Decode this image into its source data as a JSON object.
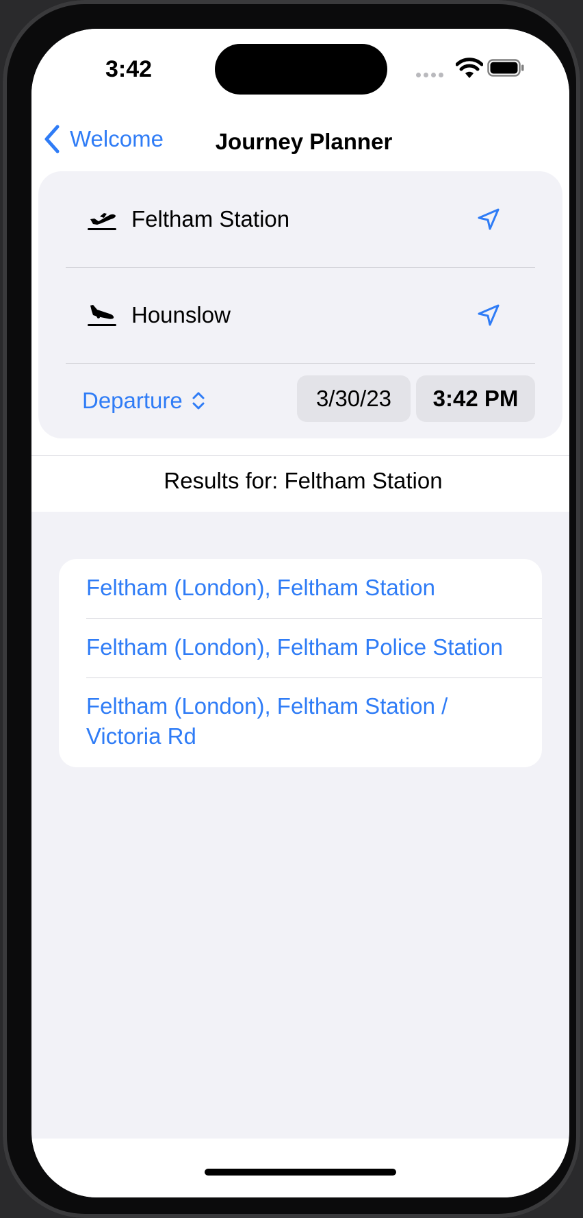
{
  "status_bar": {
    "time": "3:42"
  },
  "nav": {
    "back_label": "Welcome",
    "title": "Journey Planner"
  },
  "form": {
    "from": "Feltham Station",
    "to": "Hounslow",
    "mode": "Departure",
    "date": "3/30/23",
    "time": "3:42 PM"
  },
  "results": {
    "header": "Results for: Feltham Station",
    "items": [
      {
        "label": "Feltham (London), Feltham Station"
      },
      {
        "label": "Feltham (London), Feltham Police Station"
      },
      {
        "label": "Feltham (London), Feltham Station / Victoria Rd"
      }
    ]
  },
  "colors": {
    "accent": "#2f7cf6",
    "background": "#f2f2f7",
    "card": "#ffffff"
  },
  "icons": [
    "chevron-left-icon",
    "airplane-departure-icon",
    "airplane-arrival-icon",
    "location-arrow-icon",
    "chevron-up-down-icon",
    "wifi-icon",
    "battery-icon"
  ]
}
